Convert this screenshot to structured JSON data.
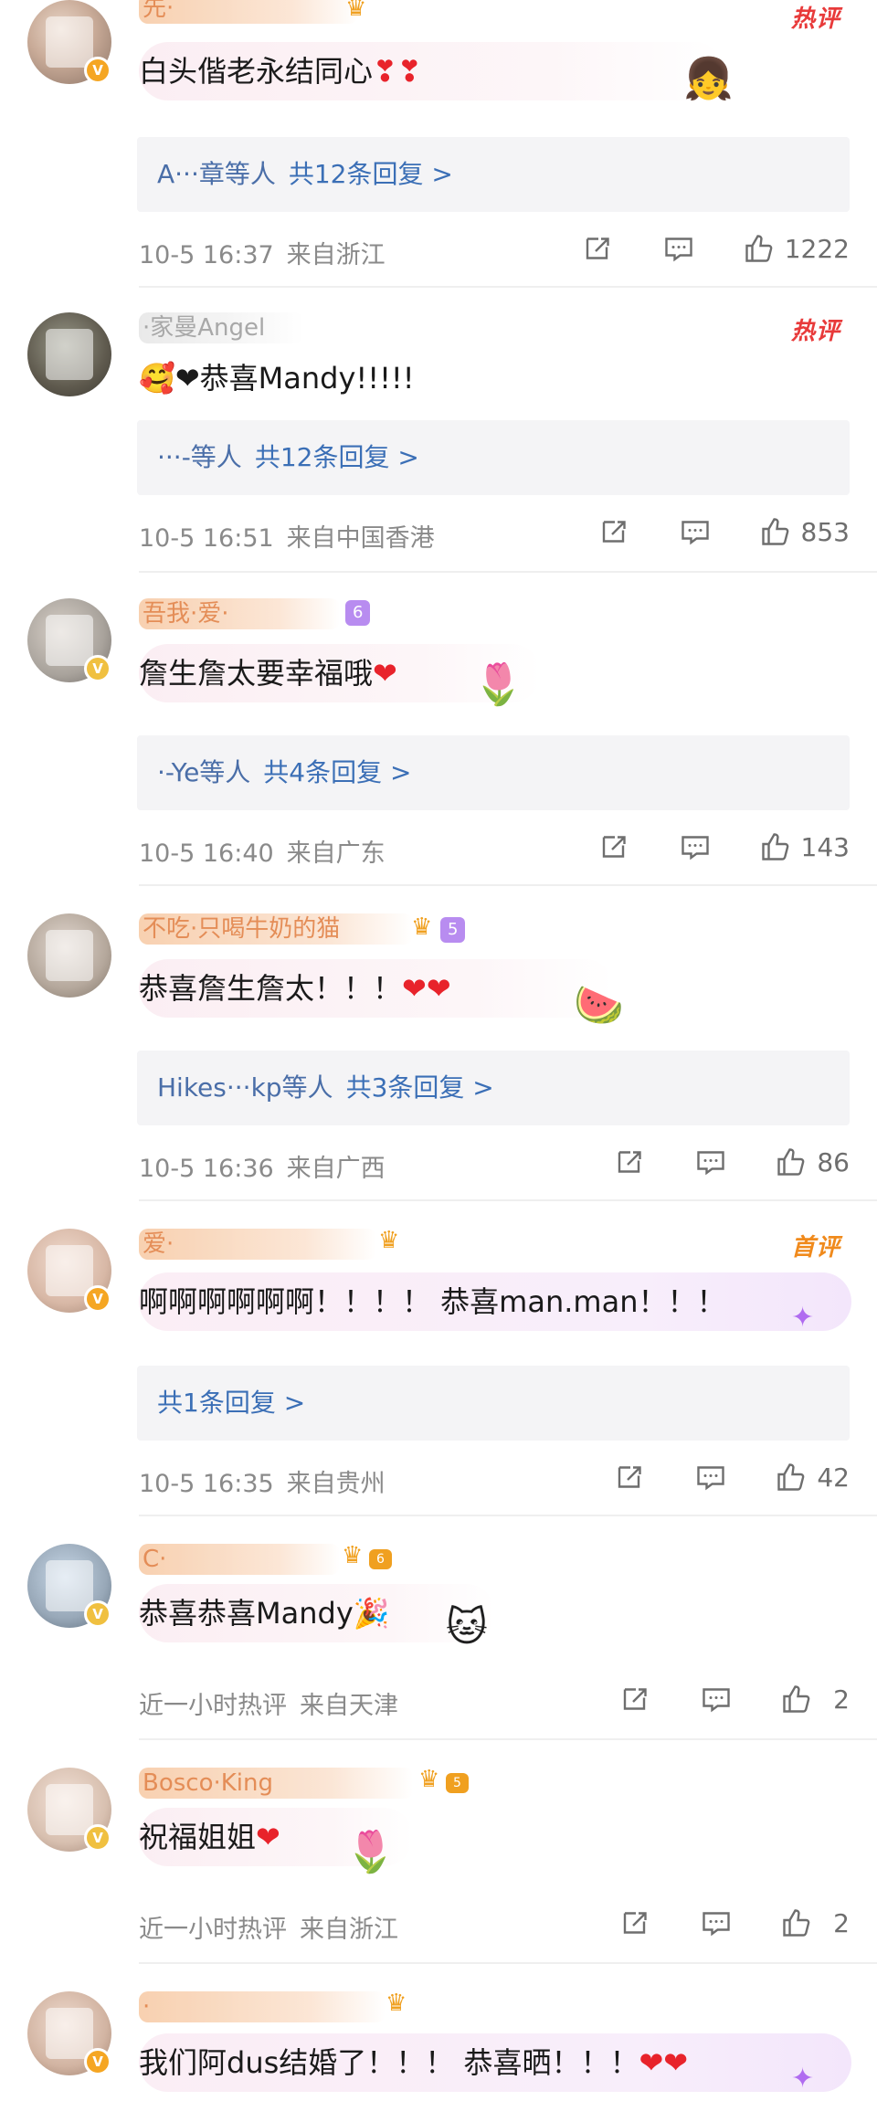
{
  "comments": [
    {
      "username": "先·",
      "tag": "热评",
      "text": "白头偕老永结同心",
      "text_suffix": "❣❣",
      "reply_names": "A···章等人",
      "reply_count": "共12条回复 >",
      "time": "10-5 16:37",
      "location": "来自浙江",
      "likes": "1222"
    },
    {
      "username": "·家曼Angel",
      "tag": "热评",
      "text_prefix": "🥰",
      "text": "❤恭喜Mandy!!!!!",
      "reply_names": "···-等人",
      "reply_count": "共12条回复 >",
      "time": "10-5 16:51",
      "location": "来自中国香港",
      "likes": "853"
    },
    {
      "username": "吾我·爱·",
      "level": "6",
      "text": "詹生詹太要幸福哦",
      "text_suffix": "❤",
      "reply_names": "·-Ye等人",
      "reply_count": "共4条回复 >",
      "time": "10-5 16:40",
      "location": "来自广东",
      "likes": "143"
    },
    {
      "username": "不吃·只喝牛奶的猫",
      "level": "5",
      "text": "恭喜詹生詹太！！！",
      "text_suffix": "❤❤",
      "reply_names": "Hikes···kp等人",
      "reply_count": "共3条回复 >",
      "time": "10-5 16:36",
      "location": "来自广西",
      "likes": "86"
    },
    {
      "username": "爱·",
      "tag": "首评",
      "text": "啊啊啊啊啊啊！！！！ 恭喜man.man！！！",
      "reply_names": "",
      "reply_count": "共1条回复 >",
      "time": "10-5 16:35",
      "location": "来自贵州",
      "likes": "42"
    },
    {
      "username": "C·",
      "level": "6",
      "text": "恭喜恭喜Mandy",
      "text_suffix": "🎉",
      "time": "近一小时热评",
      "location": "来自天津",
      "likes": "2"
    },
    {
      "username": "Bosco·King",
      "level": "5",
      "text": "祝福姐姐",
      "text_suffix": "❤",
      "time": "近一小时热评",
      "location": "来自浙江",
      "likes": "2"
    },
    {
      "username": "·",
      "text": "我们阿dus结婚了！！！ 恭喜晒！！！",
      "text_suffix": "❤❤"
    }
  ],
  "icons": {
    "share": "share-icon",
    "comment": "comment-icon",
    "like": "thumbs-up-icon"
  },
  "colors": {
    "accent_blue": "#3b6fb6",
    "hot_red": "#e83a3a",
    "first_orange": "#f08a1c",
    "meta_gray": "#8a8a8a"
  }
}
